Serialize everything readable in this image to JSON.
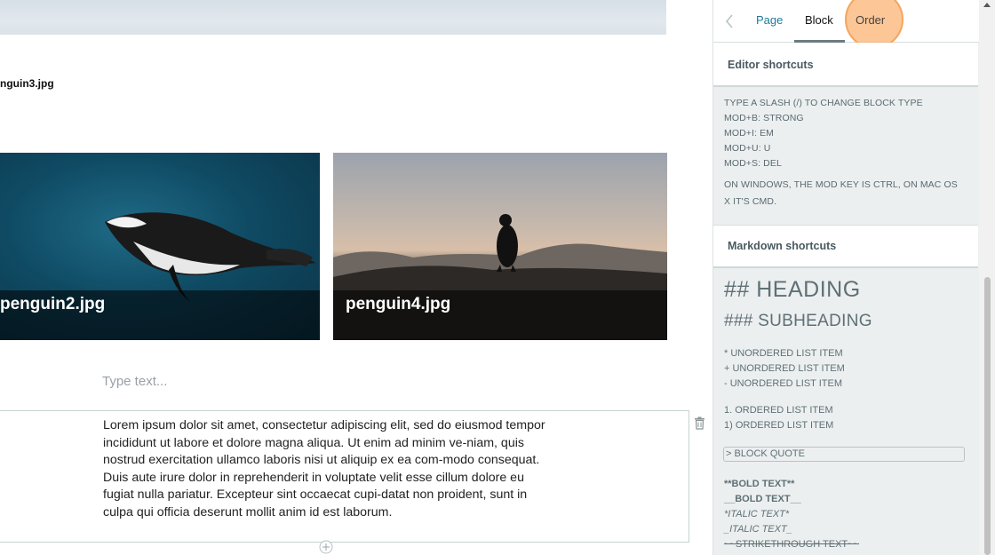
{
  "canvas": {
    "caption": "nguin3.jpg",
    "tiles": [
      {
        "title": "penguin2.jpg"
      },
      {
        "title": "penguin4.jpg"
      }
    ],
    "placeholder": "Type text...",
    "paragraph": "Lorem ipsum dolor sit amet, consectetur adipiscing elit, sed do eiusmod tempor incididunt ut labore et dolore magna aliqua. Ut enim ad minim ve-niam, quis nostrud exercitation ullamco laboris nisi ut aliquip ex ea com-modo consequat. Duis aute irure dolor in reprehenderit in voluptate velit esse cillum dolore eu fugiat nulla pariatur. Excepteur sint occaecat cupi-datat non proident, sunt in culpa qui officia deserunt mollit anim id est laborum."
  },
  "sidebar": {
    "tabs": {
      "page": "Page",
      "block": "Block",
      "order": "Order"
    },
    "editor_shortcuts": {
      "heading": "Editor shortcuts",
      "items": [
        "TYPE A SLASH (/) TO CHANGE BLOCK TYPE",
        "MOD+B: STRONG",
        "MOD+I: EM",
        "MOD+U: U",
        "MOD+S: DEL"
      ],
      "note": "ON WINDOWS, THE MOD KEY IS CTRL, ON MAC OS X IT'S CMD."
    },
    "markdown_shortcuts": {
      "heading": "Markdown shortcuts",
      "h2": "## HEADING",
      "h3": "### SUBHEADING",
      "unordered": [
        "* UNORDERED LIST ITEM",
        "+ UNORDERED LIST ITEM",
        "- UNORDERED LIST ITEM"
      ],
      "ordered": [
        "1. ORDERED LIST ITEM",
        "1) ORDERED LIST ITEM"
      ],
      "quote": "> BLOCK QUOTE",
      "bold1": "**BOLD TEXT**",
      "bold2": "__BOLD TEXT__",
      "italic1": "*ITALIC TEXT*",
      "italic2": "_ITALIC TEXT_",
      "strike": "~~STRIKETHROUGH TEXT~~"
    }
  },
  "colors": {
    "accent": "#1f7a9b",
    "highlight": "#f5a55f"
  }
}
